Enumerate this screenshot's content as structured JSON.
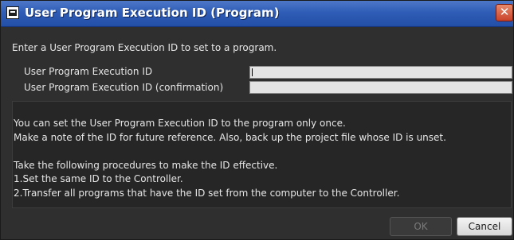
{
  "window": {
    "title": "User Program Execution ID (Program)",
    "close_symbol": "✕"
  },
  "form": {
    "instruction": "Enter a User Program Execution ID to set to a program.",
    "id_label": "User Program Execution ID",
    "id_value": "",
    "confirm_label": "User Program Execution ID (confirmation)",
    "confirm_value": ""
  },
  "info": {
    "lines": [
      "You can set the User Program Execution ID to the program only once.",
      "Make a note of the ID for future reference. Also, back up the project file whose ID is unset.",
      "Take the following procedures to make the ID effective.",
      "1.Set the same ID to the Controller.",
      "2.Transfer all programs that have the ID set from the computer to the Controller."
    ]
  },
  "buttons": {
    "ok": "OK",
    "cancel": "Cancel"
  },
  "colors": {
    "titlebar": "#2f5cb6",
    "dialog_bg": "#2f2f2f",
    "panel_bg": "#262626",
    "close_button": "#c9432a"
  },
  "icons": {
    "app": "app-window-icon",
    "close": "close-icon"
  }
}
